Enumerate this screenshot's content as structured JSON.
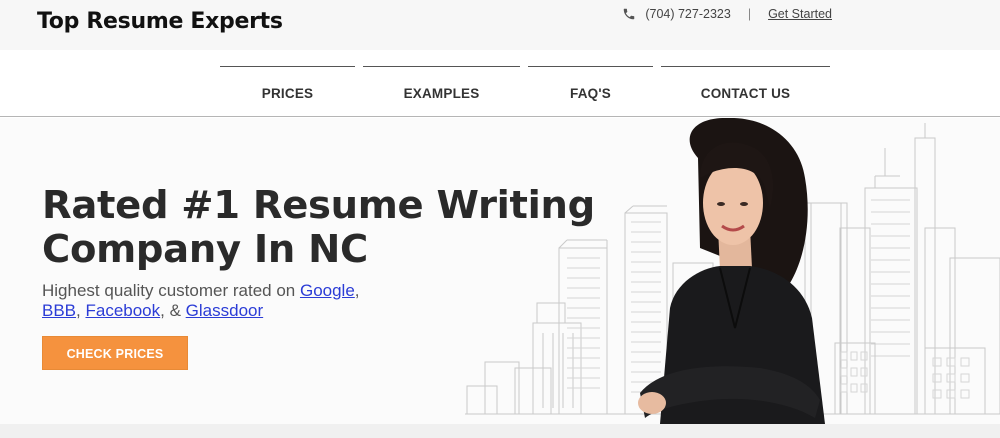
{
  "header": {
    "brand": "Top Resume Experts",
    "phone_icon": "phone-icon",
    "phone": "(704) 727-2323",
    "separator": "|",
    "get_started": "Get Started"
  },
  "nav": {
    "items": [
      {
        "label": "PRICES"
      },
      {
        "label": "EXAMPLES"
      },
      {
        "label": "FAQ'S"
      },
      {
        "label": "CONTACT US"
      }
    ]
  },
  "hero": {
    "headline_line1": "Rated #1 Resume Writing",
    "headline_line2": "Company In NC",
    "sub_prefix": "Highest quality customer rated on ",
    "link_google": "Google",
    "comma1": ",",
    "link_bbb": "BBB",
    "comma2": ", ",
    "link_facebook": "Facebook",
    "and_text": ", & ",
    "link_glassdoor": "Glassdoor",
    "cta": "CHECK PRICES"
  },
  "colors": {
    "accent": "#f5923e",
    "link": "#2b3cd6",
    "headline": "#2a2a2a"
  }
}
